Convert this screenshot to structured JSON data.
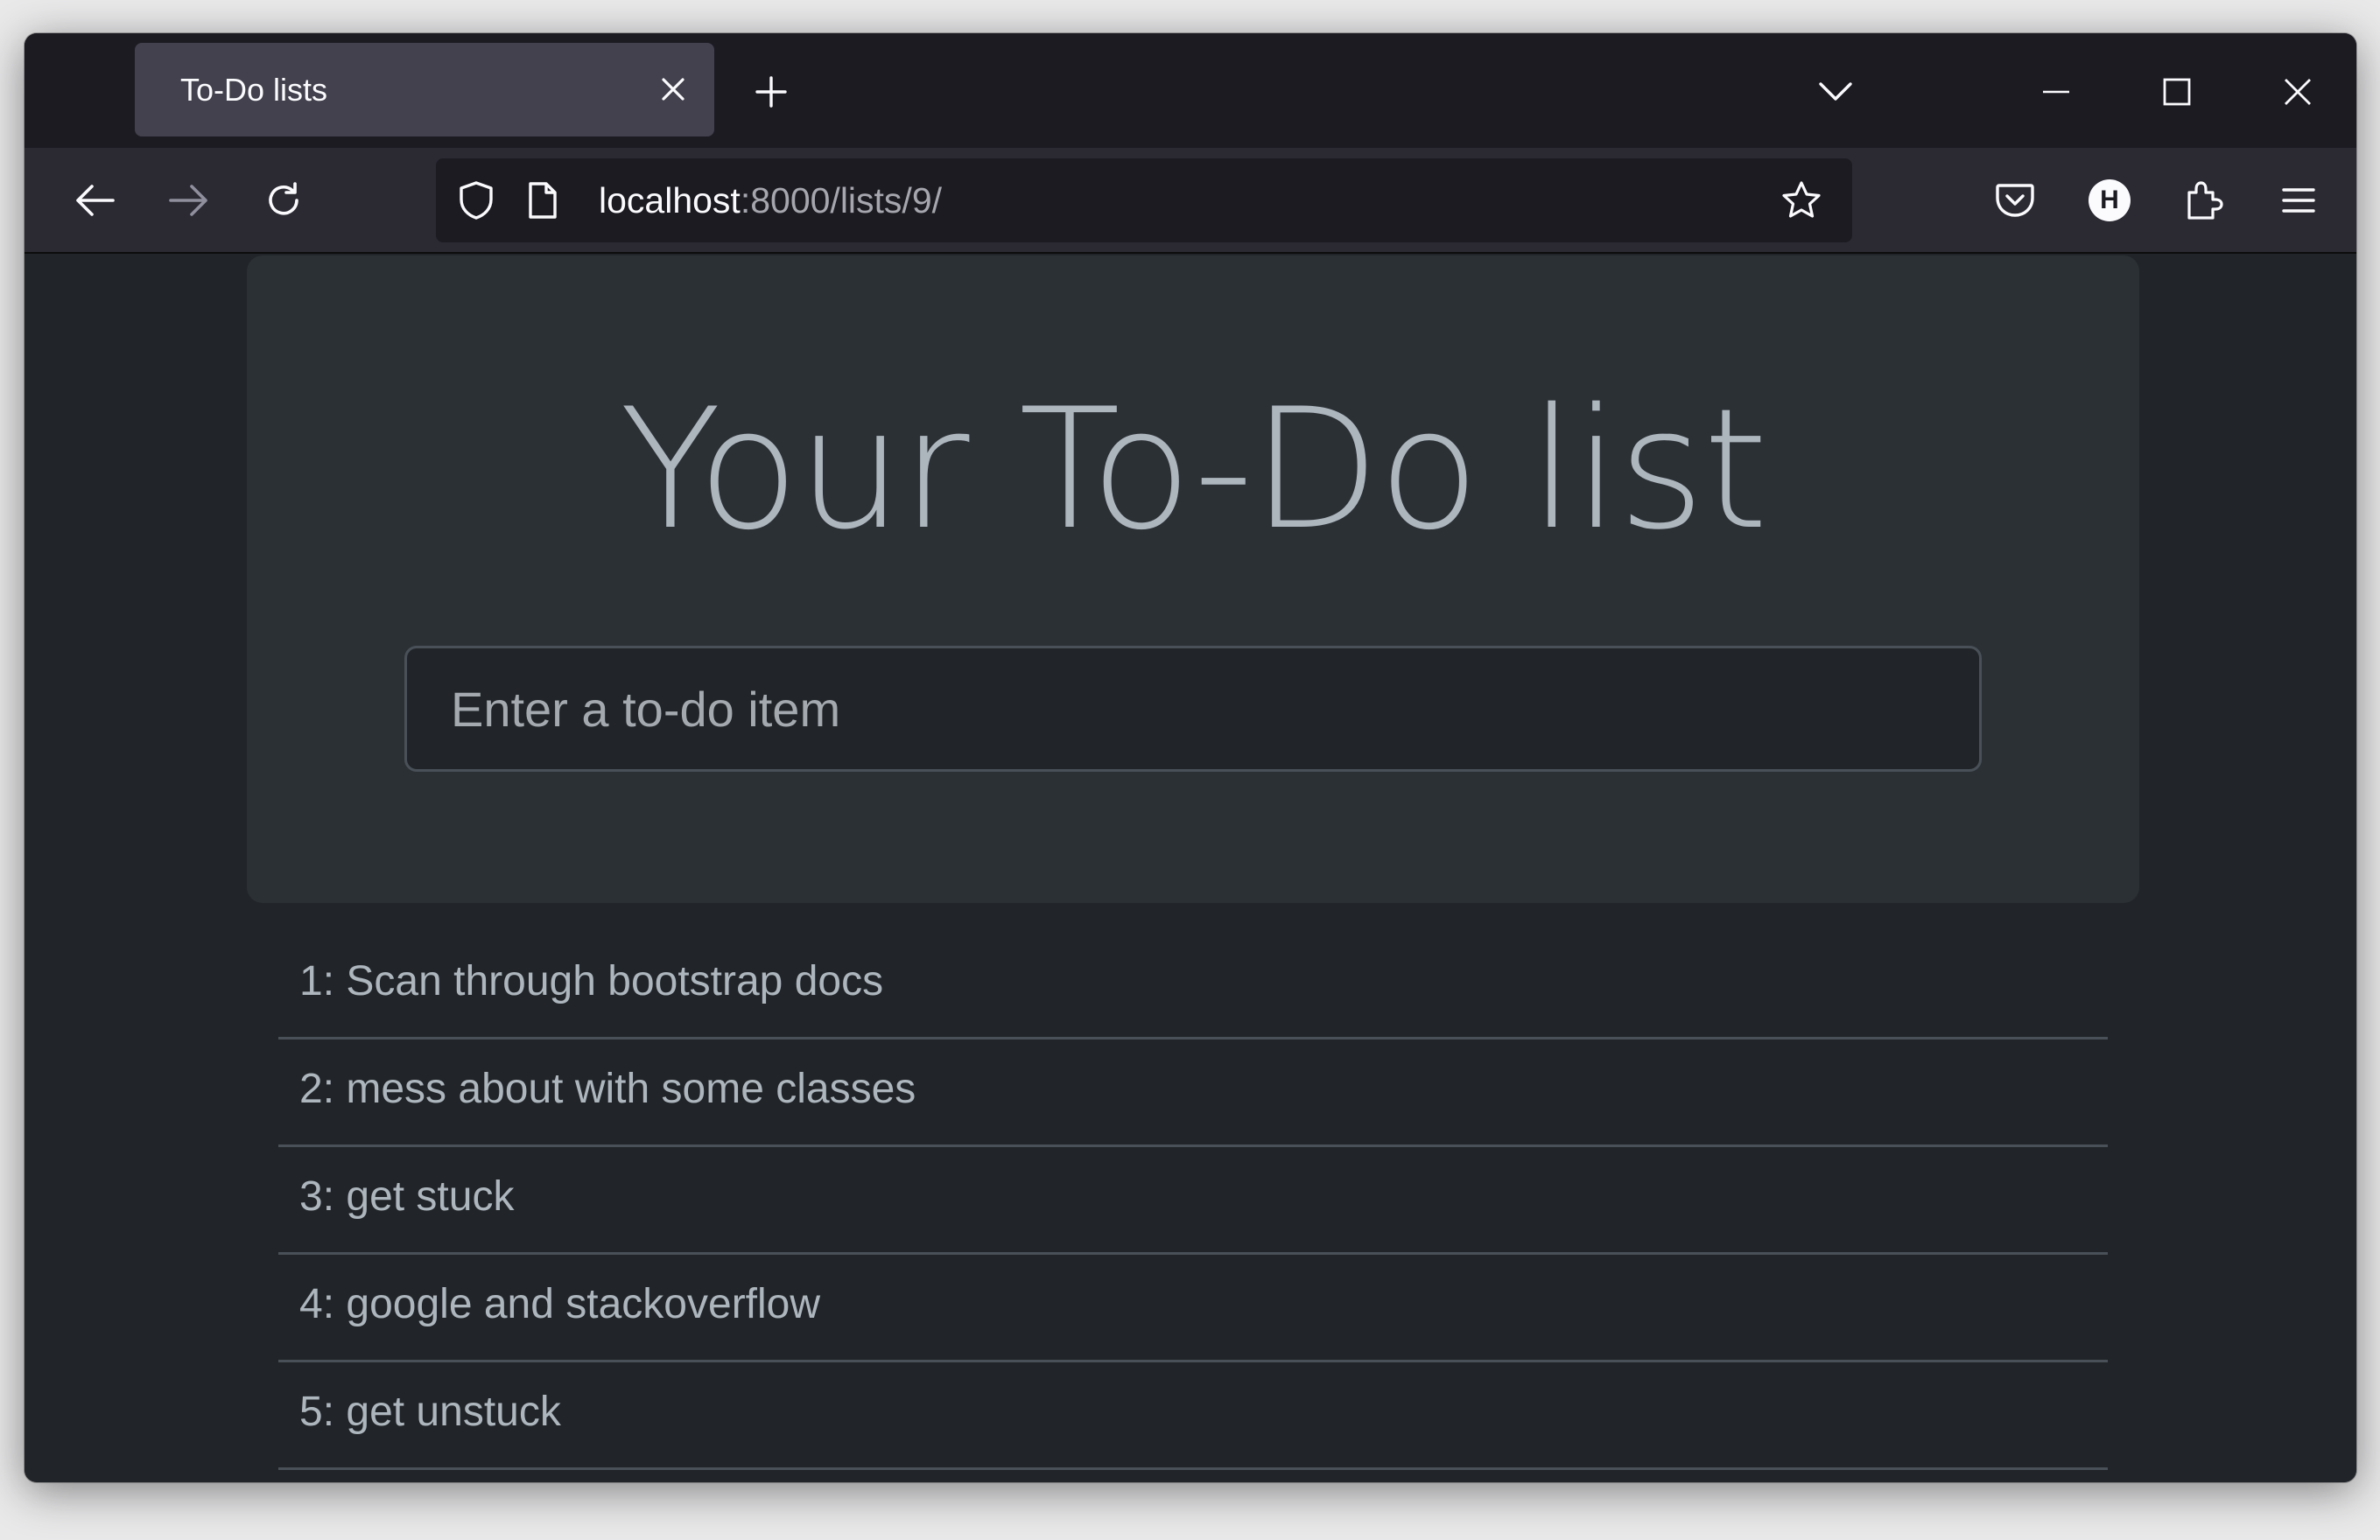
{
  "browser": {
    "tab": {
      "title": "To-Do lists"
    },
    "url": {
      "host": "localhost",
      "rest": ":8000/lists/9/"
    },
    "icons": {
      "tab_close": "close-icon",
      "new_tab": "plus-icon",
      "tab_list": "chevron-down-icon",
      "minimize": "minimize-icon",
      "maximize": "maximize-icon",
      "close_window": "close-icon",
      "back": "arrow-left-icon",
      "forward": "arrow-right-icon",
      "reload": "reload-icon",
      "shield": "shield-icon",
      "page": "page-icon",
      "bookmark": "star-icon",
      "pocket": "pocket-icon",
      "profile": "profile-avatar-icon",
      "extensions": "puzzle-icon",
      "menu": "hamburger-menu-icon"
    },
    "profile_letter": "H"
  },
  "page": {
    "title": "Your To-Do list",
    "input_placeholder": "Enter a to-do item",
    "items": [
      "1: Scan through bootstrap docs",
      "2: mess about with some classes",
      "3: get stuck",
      "4: google and stackoverflow",
      "5: get unstuck"
    ]
  },
  "colors": {
    "page_bg": "#212529",
    "jumbotron_bg": "#2b3035",
    "title_text": "#adb5bd",
    "tabstrip_bg": "#1c1b22",
    "toolbar_bg": "#2b2a33",
    "active_tab_bg": "#42414d"
  }
}
